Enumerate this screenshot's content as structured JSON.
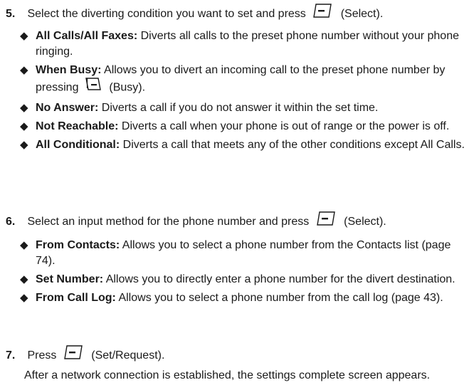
{
  "step5": {
    "number": "5.",
    "text_before": "Select the diverting condition you want to set and press",
    "text_after": "(Select).",
    "key_icon": "left-soft-key-icon"
  },
  "step5_bullets": [
    {
      "term": "All Calls/All Faxes:",
      "desc": "Diverts all calls to the preset phone number without your phone ringing."
    },
    {
      "term": "When Busy:",
      "desc_before": "Allows you to divert an incoming call to the preset phone number by pressing",
      "desc_after": "(Busy).",
      "key_icon": "right-soft-key-icon"
    },
    {
      "term": "No Answer:",
      "desc": "Diverts a call if you do not answer it within the set time."
    },
    {
      "term": "Not Reachable:",
      "desc": "Diverts a call when your phone is out of range or the power is off."
    },
    {
      "term": "All Conditional:",
      "desc": "Diverts a call that meets any of the other conditions except All Calls."
    }
  ],
  "step6": {
    "number": "6.",
    "text_before": "Select an input method for the phone number and press",
    "text_after": "(Select).",
    "key_icon": "left-soft-key-icon"
  },
  "step6_bullets": [
    {
      "term": "From Contacts:",
      "desc": "Allows you to select a phone number from the Contacts list (page 74)."
    },
    {
      "term": "Set Number:",
      "desc": "Allows you to directly enter a phone number for the divert destination."
    },
    {
      "term": "From Call Log:",
      "desc": "Allows you to select a phone number from the call log (page 43)."
    }
  ],
  "step7": {
    "number": "7.",
    "text_before": "Press",
    "text_after": "(Set/Request).",
    "key_icon": "left-soft-key-icon",
    "note": "After a network connection is established, the settings complete screen appears."
  }
}
